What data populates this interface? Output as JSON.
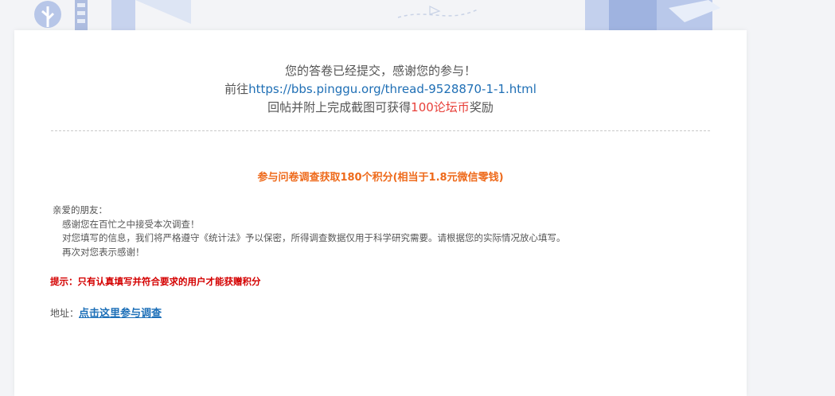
{
  "header": {
    "line1": "您的答卷已经提交，感谢您的参与！",
    "line2_prefix": "前往",
    "line2_link": "https://bbs.pinggu.org/thread-9528870-1-1.html",
    "line3_prefix": "回帖并附上完成截图可获得",
    "line3_reward": "100论坛币",
    "line3_suffix": "奖励"
  },
  "promo": "参与问卷调查获取180个积分(相当于1.8元微信零钱)",
  "letter": {
    "greeting": "亲爱的朋友：",
    "p1": "感谢您在百忙之中接受本次调查！",
    "p2": "对您填写的信息，我们将严格遵守《统计法》予以保密，所得调查数据仅用于科学研究需要。请根据您的实际情况放心填写。",
    "p3": "再次对您表示感谢！"
  },
  "tip": "提示：只有认真填写并符合要求的用户才能获赠积分",
  "address": {
    "label": "地址：",
    "link": "点击这里参与调查"
  }
}
